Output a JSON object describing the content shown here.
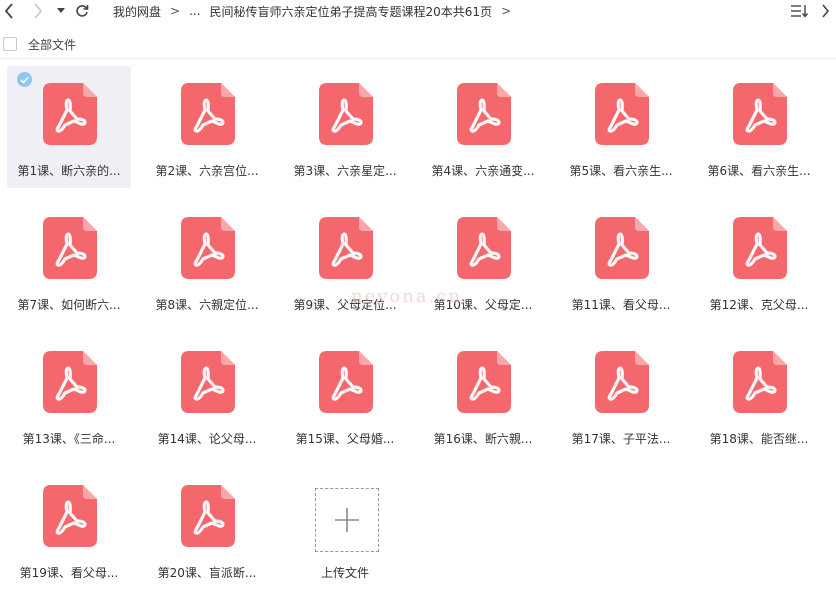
{
  "toolbar": {
    "back_icon": "chevron-left-icon",
    "forward_icon": "chevron-right-icon",
    "history_icon": "caret-down-icon",
    "refresh_icon": "refresh-icon",
    "breadcrumb": {
      "root": "我的网盘",
      "ellipsis": "...",
      "current": "民间秘传盲师六亲定位弟子提高专题课程20本共61页"
    },
    "sort_icon": "sort-icon",
    "more_icon": "chevron-right-icon"
  },
  "select_bar": {
    "label": "全部文件"
  },
  "colors": {
    "pdf_icon": "#f4676c",
    "pdf_icon_fold": "#f9a7aa",
    "selected_bg": "#eef0f6",
    "check_badge": "#8fc5f0"
  },
  "files": [
    {
      "name": "第1课、断六亲的...",
      "icon": "pdf-icon",
      "selected": true
    },
    {
      "name": "第2课、六亲宫位...",
      "icon": "pdf-icon"
    },
    {
      "name": "第3课、六亲星定...",
      "icon": "pdf-icon"
    },
    {
      "name": "第4课、六亲通变...",
      "icon": "pdf-icon"
    },
    {
      "name": "第5课、看六亲生...",
      "icon": "pdf-icon"
    },
    {
      "name": "第6课、看六亲生...",
      "icon": "pdf-icon"
    },
    {
      "name": "第7课、如何断六...",
      "icon": "pdf-icon"
    },
    {
      "name": "第8课、六親定位...",
      "icon": "pdf-icon"
    },
    {
      "name": "第9课、父母定位...",
      "icon": "pdf-icon"
    },
    {
      "name": "第10课、父母定...",
      "icon": "pdf-icon"
    },
    {
      "name": "第11课、看父母...",
      "icon": "pdf-icon"
    },
    {
      "name": "第12课、克父母...",
      "icon": "pdf-icon"
    },
    {
      "name": "第13课、《三命...",
      "icon": "pdf-icon"
    },
    {
      "name": "第14课、论父母...",
      "icon": "pdf-icon"
    },
    {
      "name": "第15课、父母婚...",
      "icon": "pdf-icon"
    },
    {
      "name": "第16课、断六親...",
      "icon": "pdf-icon"
    },
    {
      "name": "第17课、子平法...",
      "icon": "pdf-icon"
    },
    {
      "name": "第18课、能否继...",
      "icon": "pdf-icon"
    },
    {
      "name": "第19课、看父母...",
      "icon": "pdf-icon"
    },
    {
      "name": "第20课、盲派断...",
      "icon": "pdf-icon"
    }
  ],
  "upload": {
    "label": "上传文件",
    "icon": "plus-icon"
  },
  "watermark": "neyona.cn"
}
